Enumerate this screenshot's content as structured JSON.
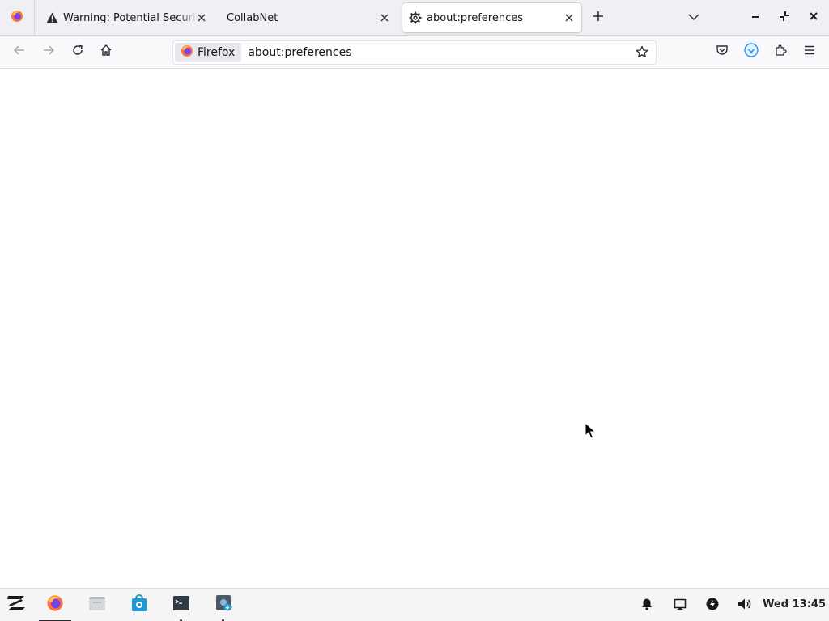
{
  "browser": {
    "tabs": [
      {
        "label": "Warning: Potential Security Risk Ahead",
        "icon": "warning-icon",
        "active": false
      },
      {
        "label": "CollabNet",
        "icon": "none",
        "active": false
      },
      {
        "label": "about:preferences",
        "icon": "gear-icon",
        "active": true
      }
    ],
    "new_tab_icon": "plus-icon",
    "list_tabs_icon": "chevron-down-icon",
    "window_controls": [
      "minimize-icon",
      "restore-icon",
      "close-icon"
    ]
  },
  "navbar": {
    "identity_label": "Firefox",
    "url": "about:preferences",
    "icons": [
      "back-icon",
      "forward-icon",
      "reload-icon",
      "home-icon",
      "bookmark-star-icon",
      "pocket-icon",
      "account-icon",
      "extensions-icon",
      "menu-icon"
    ]
  },
  "taskbar": {
    "apps": [
      "zorin-menu-icon",
      "firefox-icon",
      "files-icon",
      "software-store-icon",
      "terminal-icon",
      "screenshot-icon"
    ],
    "tray": [
      "notifications-icon",
      "display-icon",
      "power-icon",
      "volume-icon"
    ],
    "clock": "Wed 13:45"
  },
  "colors": {
    "tabbar_bg": "#f0f0f4",
    "navbar_bg": "#f9f9fb",
    "firefox_orange": "#ff7139",
    "accent_blue": "#0a84ff",
    "taskbar_bg": "#f5f5f5"
  }
}
